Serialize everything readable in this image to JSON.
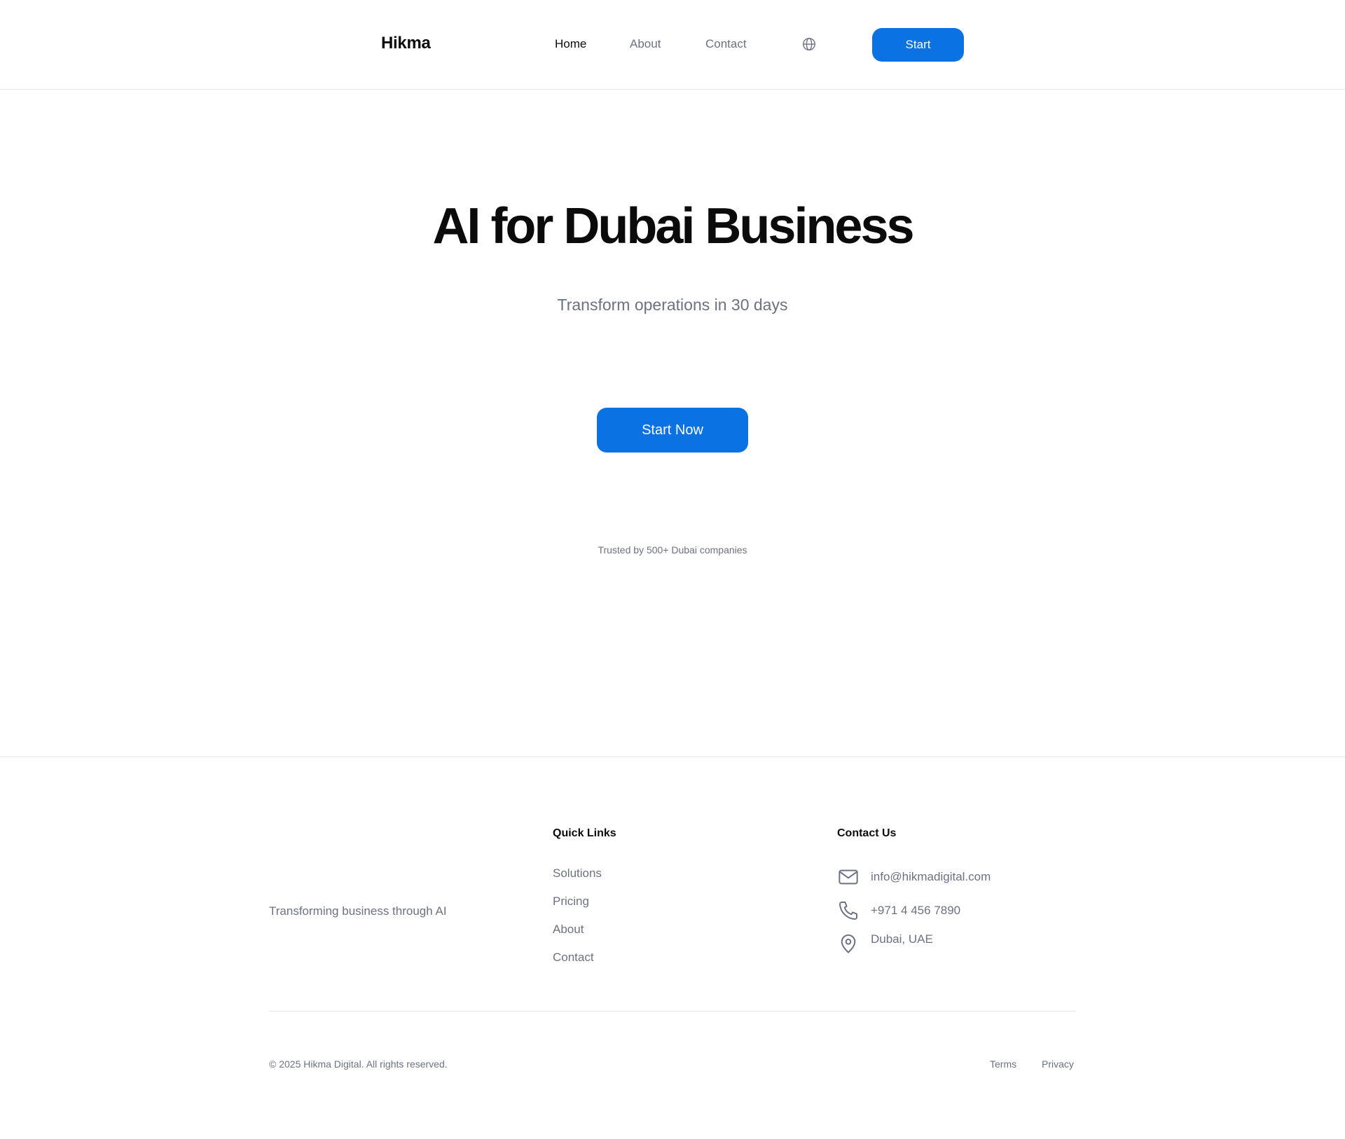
{
  "header": {
    "logo": "Hikma",
    "nav": [
      {
        "label": "Home",
        "active": true
      },
      {
        "label": "About",
        "active": false
      },
      {
        "label": "Contact",
        "active": false
      }
    ],
    "language_icon": "globe-icon",
    "cta_label": "Start"
  },
  "hero": {
    "title": "AI for Dubai Business",
    "subtitle": "Transform operations in 30 days",
    "cta_label": "Start Now",
    "trusted_text": "Trusted by 500+ Dubai companies"
  },
  "footer": {
    "tagline": "Transforming business through AI",
    "quick_links": {
      "heading": "Quick Links",
      "items": [
        "Solutions",
        "Pricing",
        "About",
        "Contact"
      ]
    },
    "contact": {
      "heading": "Contact Us",
      "email": "info@hikmadigital.com",
      "phone": "+971 4 456 7890",
      "location": "Dubai, UAE",
      "icons": [
        "mail-icon",
        "phone-icon",
        "location-pin-icon"
      ]
    },
    "copyright": "© 2025 Hikma Digital. All rights reserved.",
    "legal": {
      "terms": "Terms",
      "privacy": "Privacy"
    }
  },
  "colors": {
    "accent": "#0a72e3",
    "text_primary": "#0b0b0c",
    "text_muted": "#6b7280",
    "border": "#e5e7eb"
  }
}
